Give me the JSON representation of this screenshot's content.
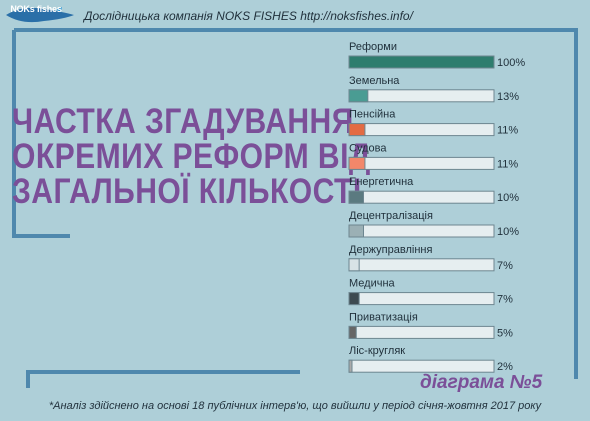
{
  "header": {
    "logo_text": "NOKs fishes",
    "text": "Дослідницька компанія NOKS FISHES http://noksfishes.info/"
  },
  "title_lines": [
    "ЧАСТКА ЗГАДУВАННЯ",
    "ОКРЕМИХ РЕФОРМ ВІД",
    "ЗАГАЛЬНОЇ КІЛЬКОСТІ"
  ],
  "chart_label": "діаграма №5",
  "footnote": "*Аналіз здійснено на основі 18 публічних інтерв'ю, що вийшли у період січня-жовтня 2017 року",
  "colors": {
    "background": "#aecfd8",
    "frame": "#4f88ad",
    "title": "#7b4f98",
    "bar_track": "#e6eef0",
    "bar_border": "#6d8690"
  },
  "chart_data": {
    "type": "bar",
    "orientation": "horizontal",
    "title": "ЧАСТКА ЗГАДУВАННЯ ОКРЕМИХ РЕФОРМ ВІД ЗАГАЛЬНОЇ КІЛЬКОСТІ",
    "categories": [
      "Реформи",
      "Земельна",
      "Пенсійна",
      "Судова",
      "Енергетична",
      "Децентралізація",
      "Держуправління",
      "Медична",
      "Приватизація",
      "Ліс-кругляк"
    ],
    "values": [
      100,
      13,
      11,
      11,
      10,
      10,
      7,
      7,
      5,
      2
    ],
    "value_labels": [
      "100%",
      "13%",
      "11%",
      "11%",
      "10%",
      "10%",
      "7%",
      "7%",
      "5%",
      "2%"
    ],
    "bar_colors": [
      "#2e7d6e",
      "#4a9c93",
      "#e36b43",
      "#f2876a",
      "#5b7a80",
      "#9bb0b5",
      "#d8e3e6",
      "#3d4a50",
      "#666666",
      "#a9a9a9"
    ],
    "xlim": [
      0,
      100
    ],
    "grid": false,
    "legend": "none"
  }
}
